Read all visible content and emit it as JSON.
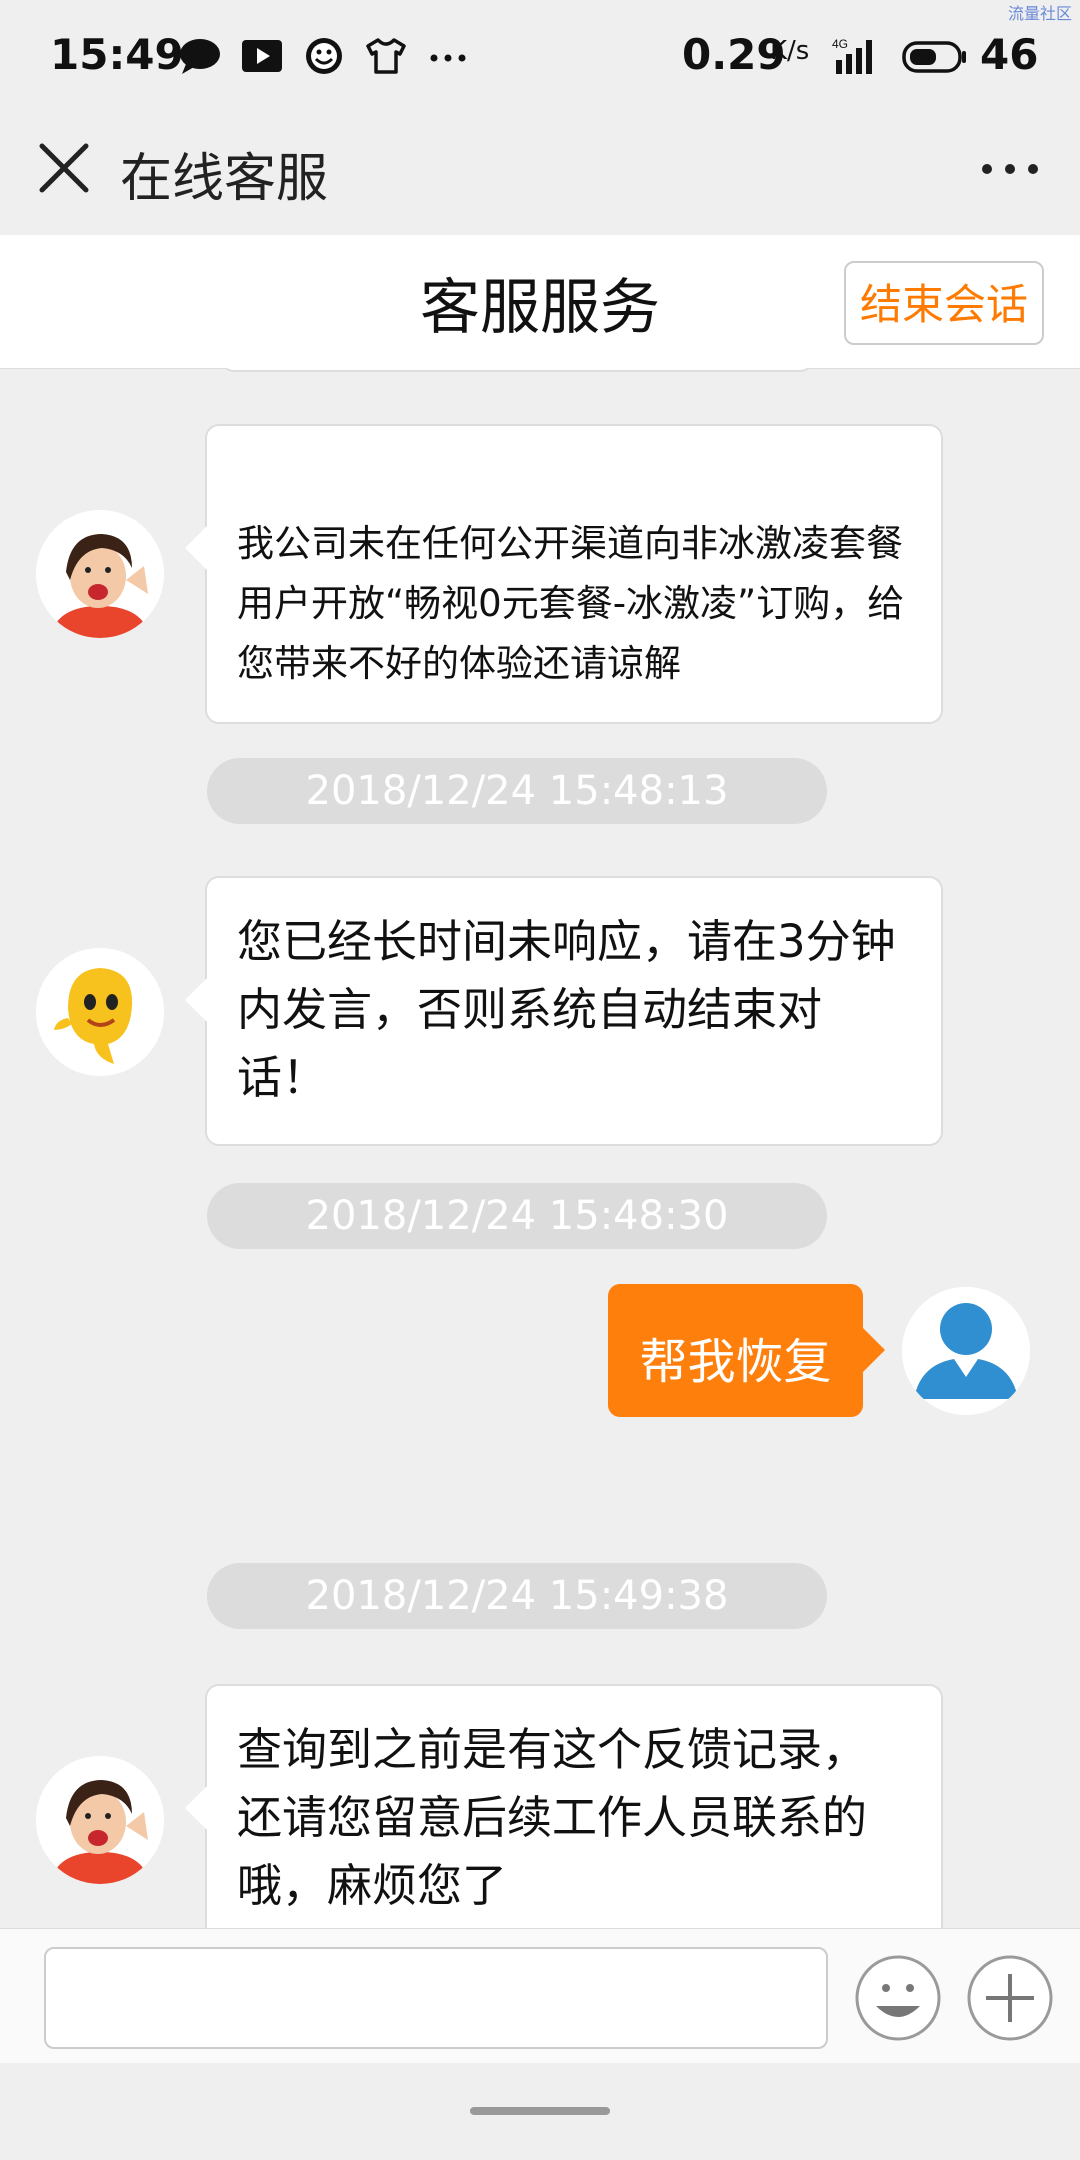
{
  "status_bar": {
    "time": "15:49",
    "speed": "0.29",
    "speed_unit": "K/s",
    "network": "4G",
    "battery_level": "46",
    "icons": [
      "message-icon",
      "play-icon",
      "smiley-icon",
      "tshirt-icon",
      "more-dots-icon"
    ]
  },
  "watermark": "流量社区",
  "nav": {
    "title": "在线客服"
  },
  "header": {
    "title": "客服服务",
    "end_button": "结束会话"
  },
  "messages": [
    {
      "from": "agent",
      "avatar": "agent-woman-avatar",
      "text": "我公司未在任何公开渠道向非冰激凌套餐用户开放“畅视0元套餐-冰激凌”订购，给您带来不好的体验还请谅解"
    },
    {
      "timestamp": "2018/12/24 15:48:13"
    },
    {
      "from": "system",
      "avatar": "mascot-avatar",
      "text": "您已经长时间未响应，请在3分钟内发言，否则系统自动结束对话！"
    },
    {
      "timestamp": "2018/12/24 15:48:30"
    },
    {
      "from": "user",
      "avatar": "user-avatar",
      "text": "帮我恢复"
    },
    {
      "timestamp": "2018/12/24 15:49:38"
    },
    {
      "from": "agent",
      "avatar": "agent-woman-avatar",
      "text": "查询到之前是有这个反馈记录，还请您留意后续工作人员联系的哦，麻烦您了"
    }
  ],
  "input": {
    "value": "",
    "placeholder": ""
  },
  "colors": {
    "accent": "#ff7f0c",
    "background": "#efefef",
    "timestamp_pill": "#dcdcdc",
    "user_avatar": "#2f8fd0"
  }
}
